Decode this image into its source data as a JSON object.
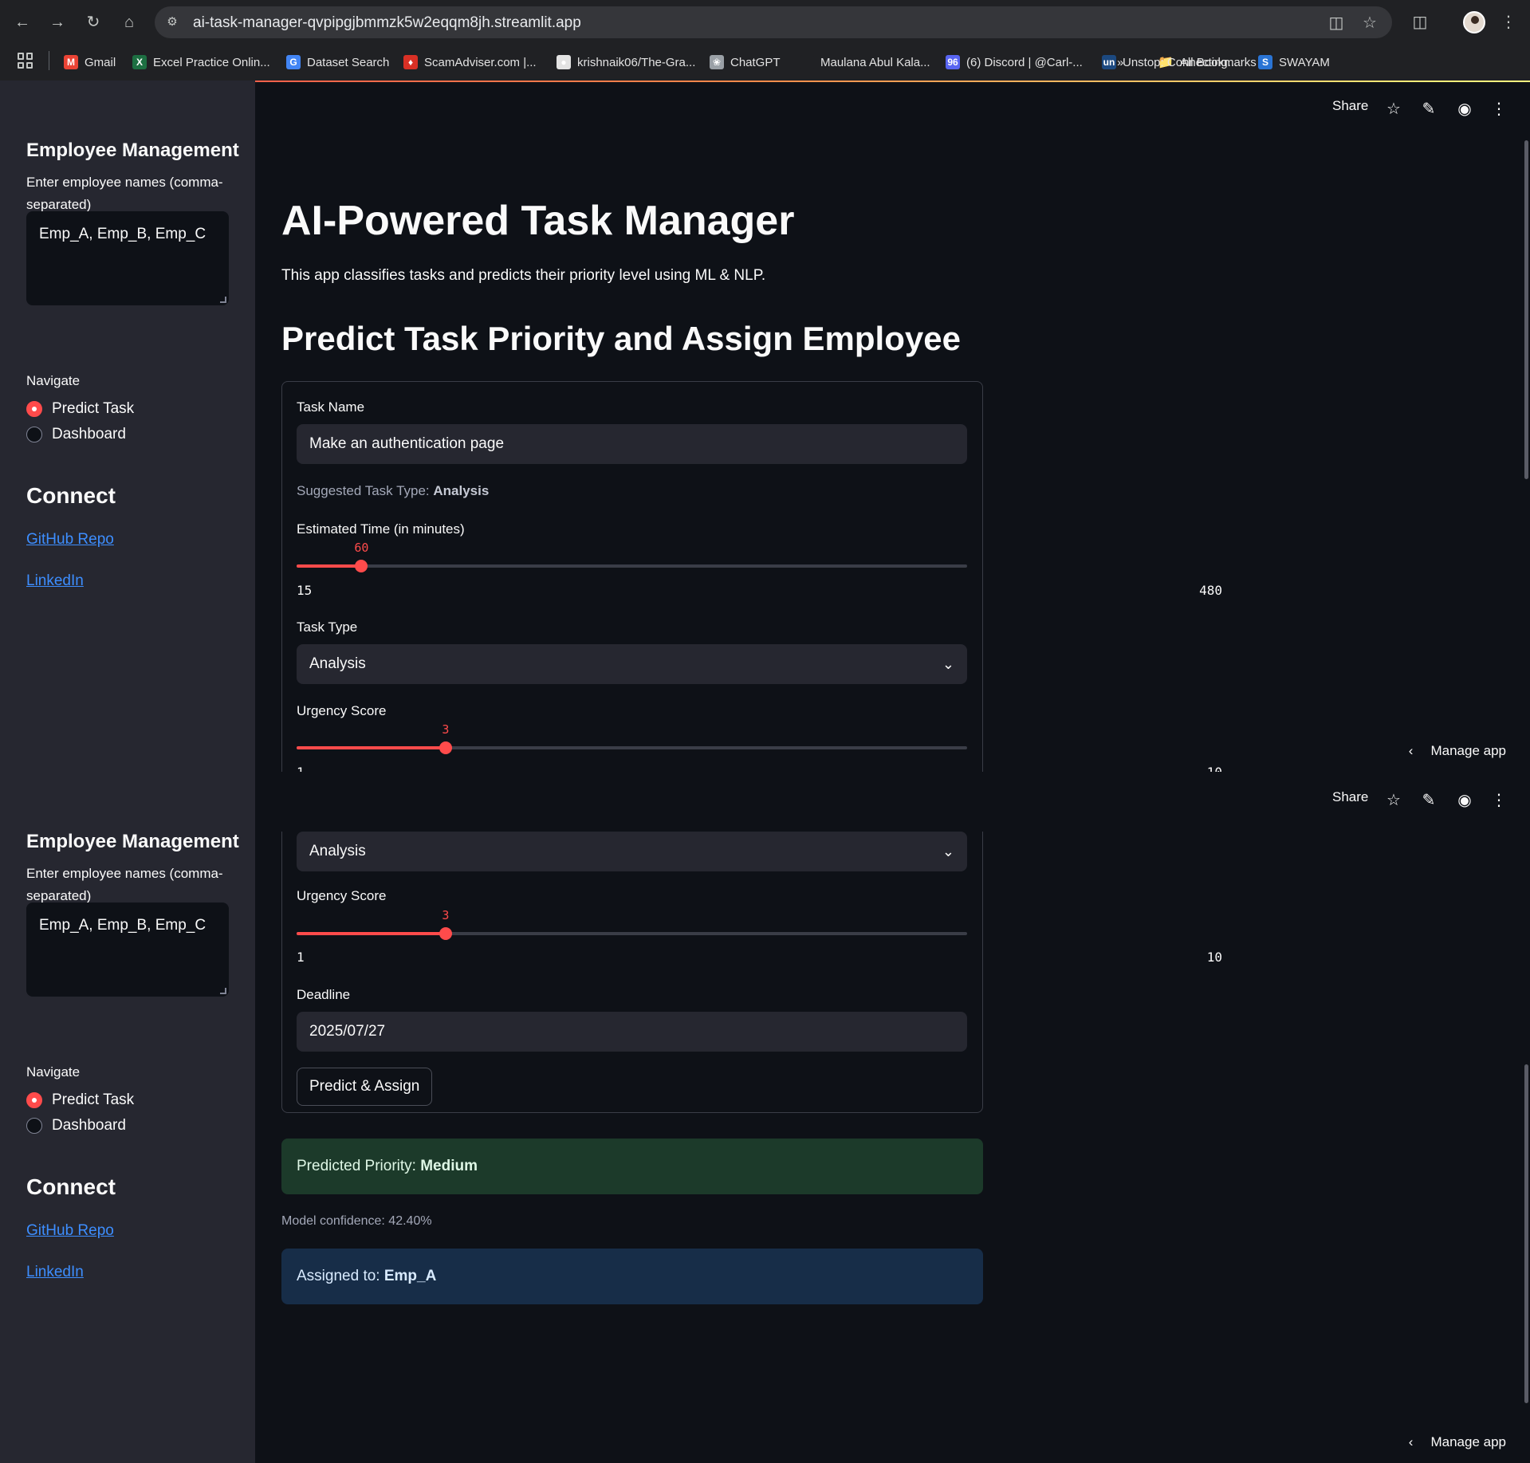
{
  "browser": {
    "url": "ai-task-manager-qvpipgjbmmzk5w2eqqm8jh.streamlit.app",
    "bookmarks": [
      {
        "label": "Gmail",
        "icon": "gmail-icon",
        "color": "#ea4335",
        "glyph": "M"
      },
      {
        "label": "Excel Practice Onlin...",
        "icon": "excel-icon",
        "color": "#1d6f42",
        "glyph": "X"
      },
      {
        "label": "Dataset Search",
        "icon": "google-icon",
        "color": "#4285f4",
        "glyph": "G"
      },
      {
        "label": "ScamAdviser.com |...",
        "icon": "shield-icon",
        "color": "#d93025",
        "glyph": "♦"
      },
      {
        "label": "krishnaik06/The-Gra...",
        "icon": "github-icon",
        "color": "#e3e3e3",
        "glyph": "●"
      },
      {
        "label": "ChatGPT",
        "icon": "chatgpt-icon",
        "color": "#9aa0a6",
        "glyph": "❀"
      },
      {
        "label": "Maulana Abul Kala...",
        "icon": "site-icon",
        "color": "#202124",
        "glyph": ""
      },
      {
        "label": "(6) Discord | @Carl-...",
        "icon": "discord-icon",
        "color": "#5865f2",
        "glyph": "96"
      },
      {
        "label": "Unstop: Connecting...",
        "icon": "unstop-icon",
        "color": "#1c4980",
        "glyph": "un"
      },
      {
        "label": "SWAYAM",
        "icon": "swayam-icon",
        "color": "#2a74d4",
        "glyph": "S"
      }
    ],
    "overflow": "»",
    "all_bookmarks": "All Bookmarks"
  },
  "sidebar": {
    "heading": "Employee Management",
    "employees_label": "Enter employee names (comma-separated)",
    "employees_value": "Emp_A, Emp_B, Emp_C",
    "navigate_label": "Navigate",
    "nav_options": [
      "Predict Task",
      "Dashboard"
    ],
    "nav_selected": "Predict Task",
    "connect_heading": "Connect",
    "links": [
      "GitHub Repo",
      "LinkedIn"
    ]
  },
  "header": {
    "share": "Share",
    "manage_app": "Manage app"
  },
  "main": {
    "title": "AI-Powered Task Manager",
    "subtitle": "This app classifies tasks and predicts their priority level using ML & NLP.",
    "section_title": "Predict Task Priority and Assign Employee",
    "task_name_label": "Task Name",
    "task_name_value": "Make an authentication page",
    "suggested_prefix": "Suggested Task Type: ",
    "suggested_value": "Analysis",
    "est_time_label": "Estimated Time (in minutes)",
    "est_time": {
      "value": "60",
      "min": "15",
      "max": "480",
      "fraction": 0.0968
    },
    "task_type_label": "Task Type",
    "task_type_value": "Analysis",
    "urgency_label": "Urgency Score",
    "urgency": {
      "value": "3",
      "min": "1",
      "max": "10",
      "fraction": 0.2222
    },
    "deadline_label": "Deadline",
    "deadline_value": "2025/07/27",
    "submit_label": "Predict & Assign",
    "priority_prefix": "Predicted Priority: ",
    "priority_value": "Medium",
    "confidence": "Model confidence: 42.40%",
    "assigned_prefix": "Assigned to: ",
    "assigned_value": "Emp_A"
  }
}
